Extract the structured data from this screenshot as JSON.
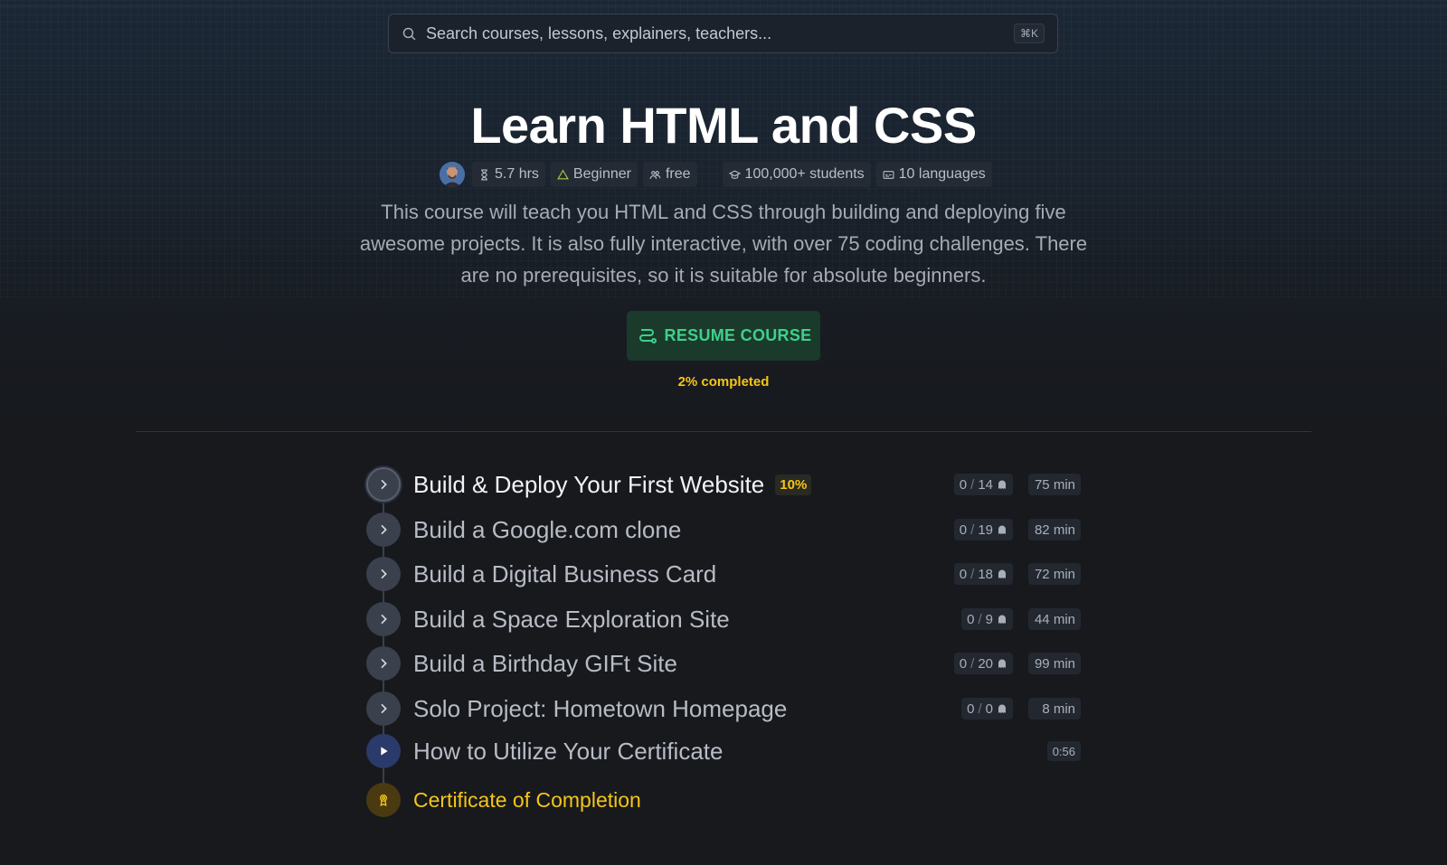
{
  "search": {
    "placeholder": "Search courses, lessons, explainers, teachers...",
    "shortcut": "⌘K"
  },
  "course": {
    "title": "Learn HTML and CSS",
    "meta": {
      "duration": "5.7 hrs",
      "level": "Beginner",
      "price": "free",
      "students": "100,000+ students",
      "languages": "10 languages"
    },
    "description": "This course will teach you HTML and CSS through building and deploying five awesome projects. It is also fully interactive, with over 75 coding challenges. There are no prerequisites, so it is suitable for absolute beginners.",
    "resume_label": "RESUME COURSE",
    "progress_text": "2% completed",
    "progress_percent": 2
  },
  "lessons": [
    {
      "title": "Build & Deploy Your First Website",
      "badge": "10%",
      "done": "0",
      "total": "14",
      "duration": "75 min"
    },
    {
      "title": "Build a Google.com clone",
      "done": "0",
      "total": "19",
      "duration": "82 min"
    },
    {
      "title": "Build a Digital Business Card",
      "done": "0",
      "total": "18",
      "duration": "72 min"
    },
    {
      "title": "Build a Space Exploration Site",
      "done": "0",
      "total": "9",
      "duration": "44 min"
    },
    {
      "title": "Build a Birthday GIFt Site",
      "done": "0",
      "total": "20",
      "duration": "99 min"
    },
    {
      "title": "Solo Project: Hometown Homepage",
      "done": "0",
      "total": "0",
      "duration": "8 min"
    }
  ],
  "video": {
    "title": "How to Utilize Your Certificate",
    "time": "0:56"
  },
  "certificate": {
    "title": "Certificate of Completion"
  },
  "colors": {
    "background": "#17191d",
    "accent_green": "#3fd08a",
    "accent_yellow": "#f5c518"
  },
  "icons": {
    "search": "search-icon",
    "duration": "hourglass-icon",
    "level": "triangle-icon",
    "price": "people-icon",
    "students": "graduation-icon",
    "languages": "subtitles-icon",
    "resume": "path-icon",
    "chevron": "chevron-right-icon",
    "challenge": "ghost-icon",
    "play": "play-icon",
    "certificate": "award-icon"
  }
}
